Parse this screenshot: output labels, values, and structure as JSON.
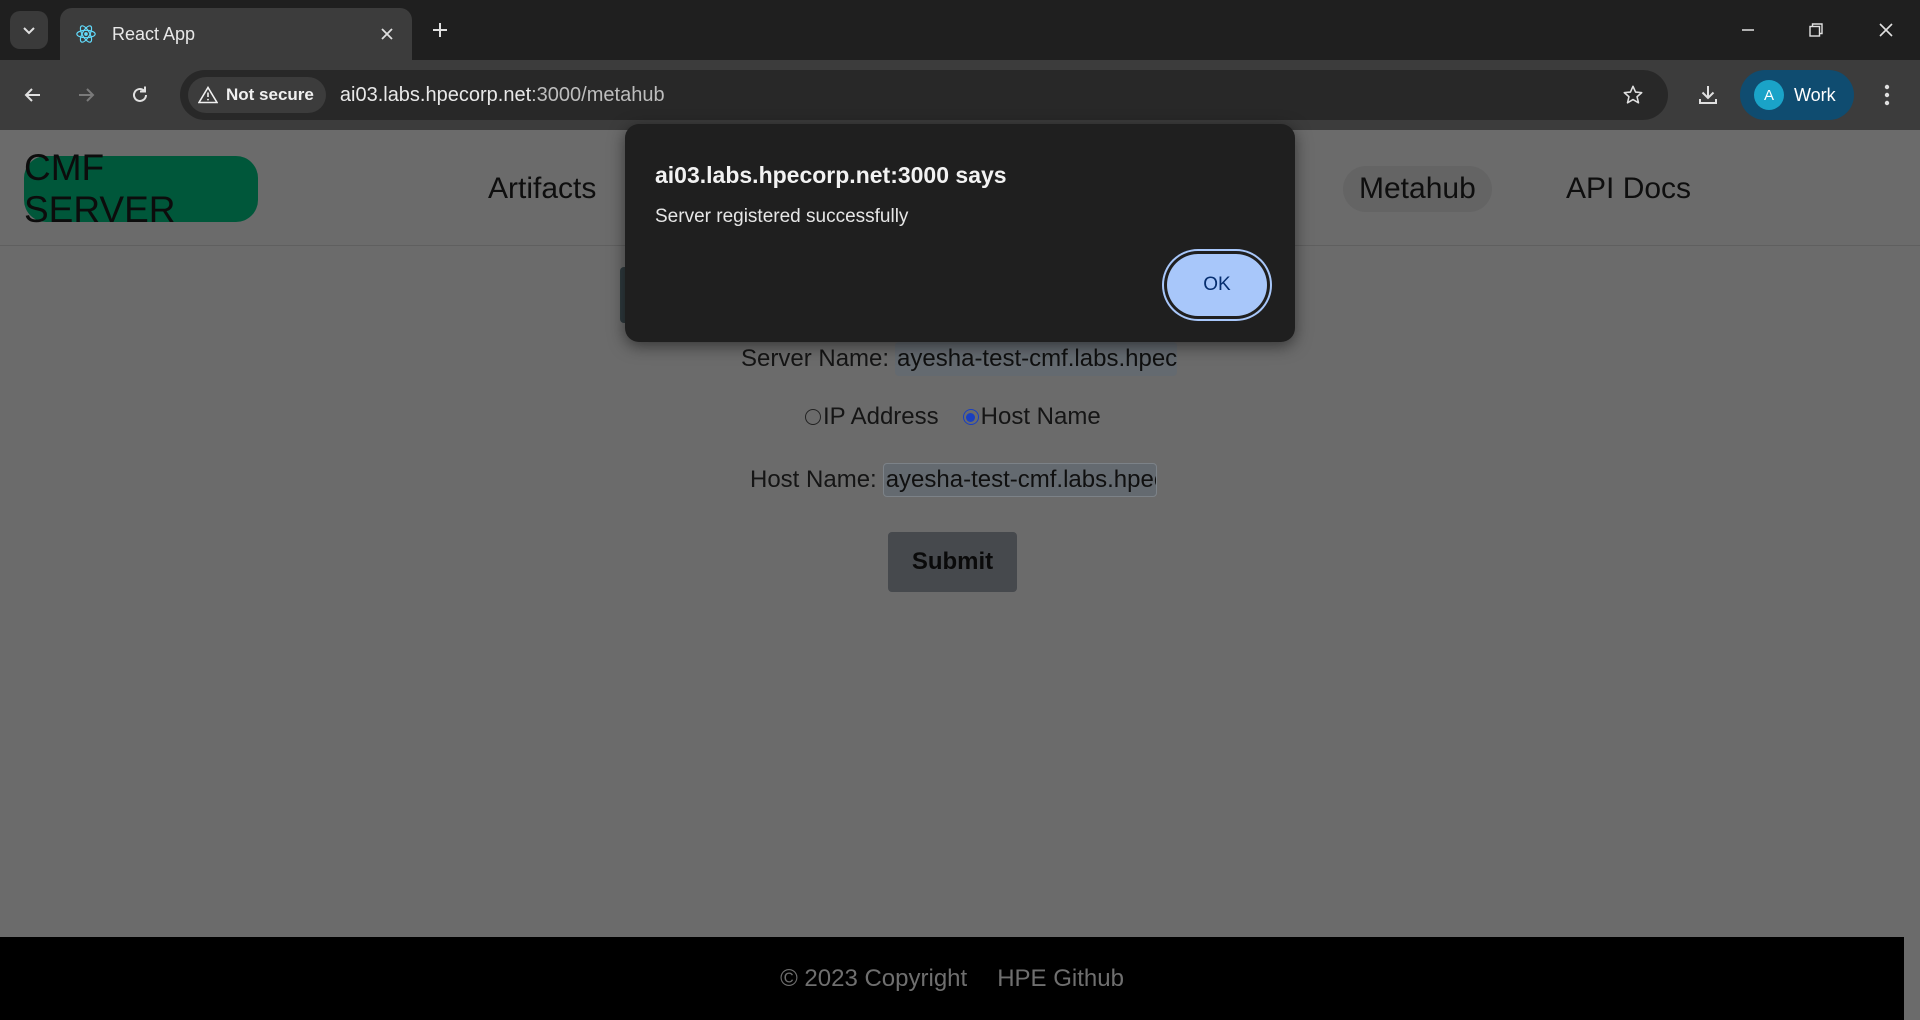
{
  "browser": {
    "tab_title": "React App",
    "security_label": "Not secure",
    "url_host": "ai03.labs.hpecorp.net",
    "url_path": ":3000/metahub",
    "profile_initial": "A",
    "profile_label": "Work"
  },
  "navbar": {
    "brand": "CMF SERVER",
    "links": [
      "Artifacts",
      "Metahub",
      "API Docs"
    ]
  },
  "form": {
    "server_name_label": "Server Name:",
    "server_name_value": "ayesha-test-cmf.labs.hpec",
    "radio_ip_label": "IP Address",
    "radio_host_label": "Host Name",
    "host_name_label": "Host Name:",
    "host_name_value": "ayesha-test-cmf.labs.hpec",
    "submit_label": "Submit"
  },
  "footer": {
    "copyright": "© 2023 Copyright",
    "github": "HPE Github"
  },
  "dialog": {
    "title": "ai03.labs.hpecorp.net:3000 says",
    "message": "Server registered successfully",
    "ok_label": "OK"
  }
}
